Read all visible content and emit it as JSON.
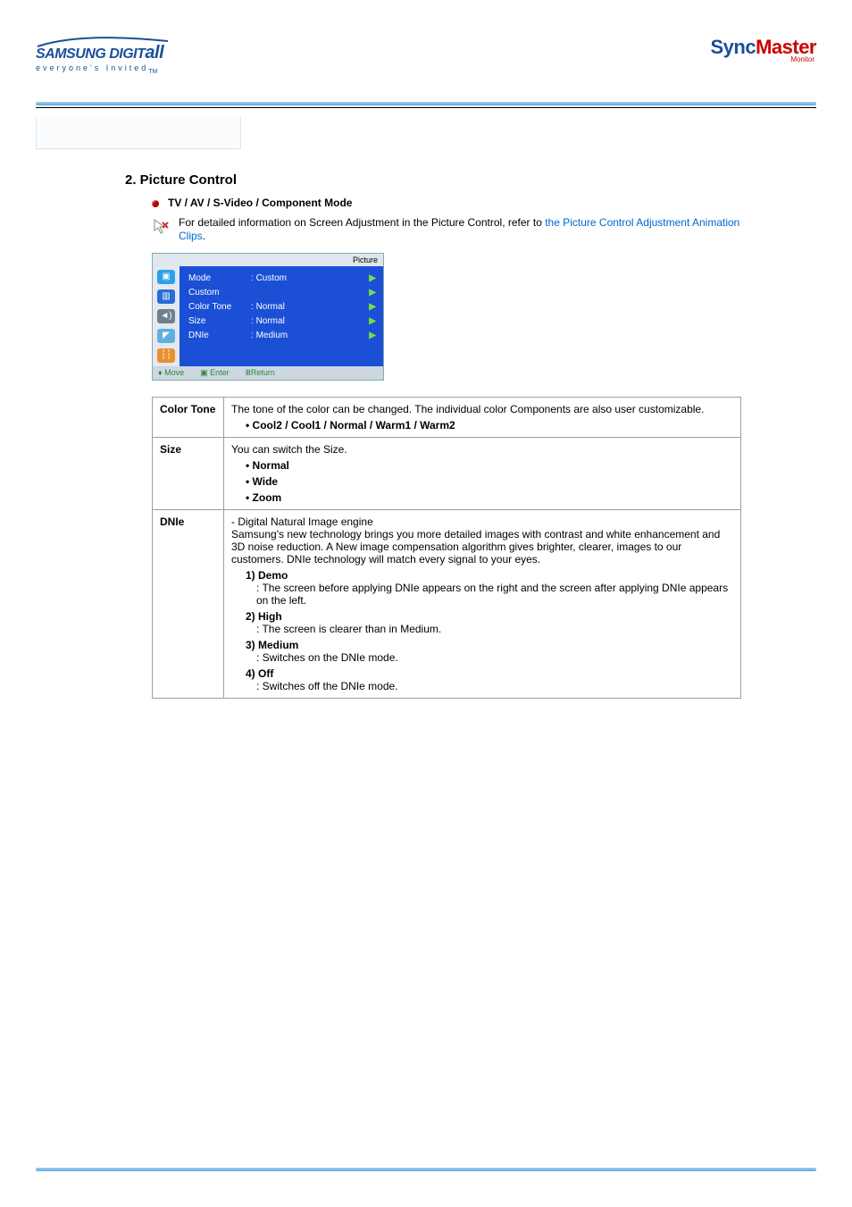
{
  "header": {
    "brand_main": "SAMSUNG DIGIT",
    "brand_tail": "all",
    "tagline": "everyone's Invited",
    "tagline_tm": "TM",
    "sync_a": "Sync",
    "sync_b": "Master",
    "sync_sub": "Monitor"
  },
  "section": {
    "number_title": "2. Picture Control",
    "mode_line": "TV / AV / S-Video / Component Mode",
    "info_pre": "For detailed information on Screen Adjustment in the Picture Control, refer to ",
    "info_link": "the Picture Control Adjustment Animation Clips",
    "info_post": "."
  },
  "osd": {
    "panel_title": "Picture",
    "rows": [
      {
        "label": "Mode",
        "value": "Custom"
      },
      {
        "label": "Custom",
        "value": ""
      },
      {
        "label": "Color Tone",
        "value": "Normal"
      },
      {
        "label": "Size",
        "value": "Normal"
      },
      {
        "label": "DNIe",
        "value": "Medium"
      }
    ],
    "footer": {
      "move": "Move",
      "enter": "Enter",
      "ret": "Return"
    }
  },
  "desc": {
    "color_tone": {
      "name": "Color Tone",
      "body": "The tone of the color can be changed. The individual color Components are also user customizable.",
      "options": "• Cool2 / Cool1 / Normal / Warm1 / Warm2"
    },
    "size": {
      "name": "Size",
      "body": "You can switch the Size.",
      "opts": [
        "• Normal",
        "• Wide",
        "• Zoom"
      ]
    },
    "dnie": {
      "name": "DNIe",
      "l1": "- Digital Natural Image engine",
      "l2": "Samsung's new technology brings you more detailed images with contrast and white enhancement and 3D noise reduction. A New image compensation algorithm gives brighter, clearer, images to our customers. DNIe technology will match every signal to your eyes.",
      "h1": "1) Demo",
      "d1": ": The screen before applying DNIe appears on the right and the screen after applying DNIe appears on the left.",
      "h2": "2) High",
      "d2": ": The screen is clearer than in Medium.",
      "h3": "3) Medium",
      "d3": ": Switches on the DNIe mode.",
      "h4": "4) Off",
      "d4": ": Switches off the DNIe mode."
    }
  }
}
